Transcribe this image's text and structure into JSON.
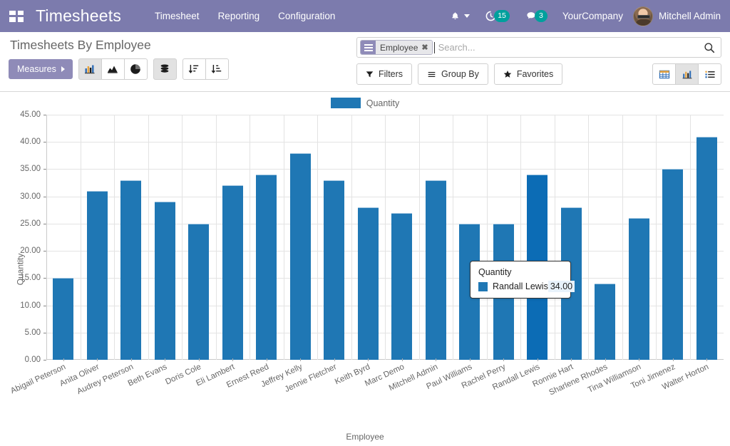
{
  "navbar": {
    "apps_icon": "apps-grid-icon",
    "brand": "Timesheets",
    "menus": [
      {
        "label": "Timesheet"
      },
      {
        "label": "Reporting"
      },
      {
        "label": "Configuration"
      }
    ],
    "activity_count": "15",
    "messages_count": "3",
    "company": "YourCompany",
    "user": "Mitchell Admin"
  },
  "control_panel": {
    "page_title": "Timesheets By Employee",
    "measures_label": "Measures",
    "chart_type_buttons": [
      {
        "name": "bar-chart-icon",
        "active": true
      },
      {
        "name": "line-chart-icon",
        "active": false
      },
      {
        "name": "pie-chart-icon",
        "active": false
      }
    ],
    "stacked_button": {
      "name": "stacked-icon",
      "active": true
    },
    "sort_buttons": [
      {
        "name": "sort-descending-icon",
        "active": false
      },
      {
        "name": "sort-ascending-icon",
        "active": false
      }
    ],
    "search": {
      "facet_label": "Employee",
      "facet_remove": "✖",
      "placeholder": "Search..."
    },
    "filters_label": "Filters",
    "group_by_label": "Group By",
    "favorites_label": "Favorites",
    "view_switcher": [
      {
        "name": "pivot-view-icon",
        "active": false
      },
      {
        "name": "graph-view-icon",
        "active": true
      },
      {
        "name": "list-view-icon",
        "active": false
      }
    ]
  },
  "chart_data": {
    "type": "bar",
    "title": "",
    "xlabel": "Employee",
    "ylabel": "Quantity",
    "ylim": [
      0,
      45
    ],
    "yticks": [
      "0.00",
      "5.00",
      "10.00",
      "15.00",
      "20.00",
      "25.00",
      "30.00",
      "35.00",
      "40.00",
      "45.00"
    ],
    "ytick_values": [
      0,
      5,
      10,
      15,
      20,
      25,
      30,
      35,
      40,
      45
    ],
    "grid": true,
    "legend": {
      "position": "top",
      "entries": [
        {
          "name": "Quantity",
          "color": "#1f77b4"
        }
      ]
    },
    "bar_color": "#1f77b4",
    "highlight_color": "#0c6cb5",
    "categories": [
      "Abigail Peterson",
      "Anita Oliver",
      "Audrey Peterson",
      "Beth Evans",
      "Doris Cole",
      "Eli Lambert",
      "Ernest Reed",
      "Jeffrey Kelly",
      "Jennie Fletcher",
      "Keith Byrd",
      "Marc Demo",
      "Mitchell Admin",
      "Paul Williams",
      "Rachel Perry",
      "Randall Lewis",
      "Ronnie Hart",
      "Sharlene Rhodes",
      "Tina Williamson",
      "Toni Jimenez",
      "Walter Horton"
    ],
    "series": [
      {
        "name": "Quantity",
        "values": [
          15,
          31,
          33,
          29,
          25,
          32,
          34,
          38,
          33,
          28,
          27,
          33,
          25,
          25,
          34,
          28,
          14,
          26,
          35,
          41
        ]
      }
    ],
    "highlighted_index": 14,
    "tooltip": {
      "title": "Quantity",
      "label": "Randall Lewis",
      "value": "34.00"
    }
  }
}
